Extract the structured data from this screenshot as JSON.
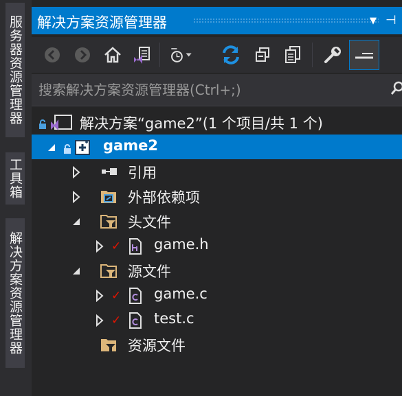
{
  "side_tabs": [
    "服务器资源管理器",
    "工具箱",
    "解决方案资源管理器"
  ],
  "panel": {
    "title": "解决方案资源管理器",
    "dropdown_icon": "dropdown-arrow",
    "pin_icon": "pin-icon"
  },
  "toolbar": {
    "buttons": [
      "back-icon",
      "forward-icon",
      "home-icon",
      "vs-switch-view-icon",
      "pending-changes-filter-icon",
      "sync-active-document-icon",
      "collapse-all-icon",
      "show-all-files-icon",
      "properties-icon",
      "preview-selected-icon"
    ]
  },
  "search": {
    "placeholder": "搜索解决方案资源管理器(Ctrl+;)"
  },
  "tree": {
    "solution": "解决方案“game2”(1 个项目/共 1 个)",
    "project": "game2",
    "references": "引用",
    "external_deps": "外部依赖项",
    "header_files": "头文件",
    "header_file_1": "game.h",
    "source_files": "源文件",
    "source_file_1": "game.c",
    "source_file_2": "test.c",
    "resource_files": "资源文件"
  },
  "colors": {
    "accent": "#007acc",
    "background": "#252526",
    "check": "#e51400"
  }
}
